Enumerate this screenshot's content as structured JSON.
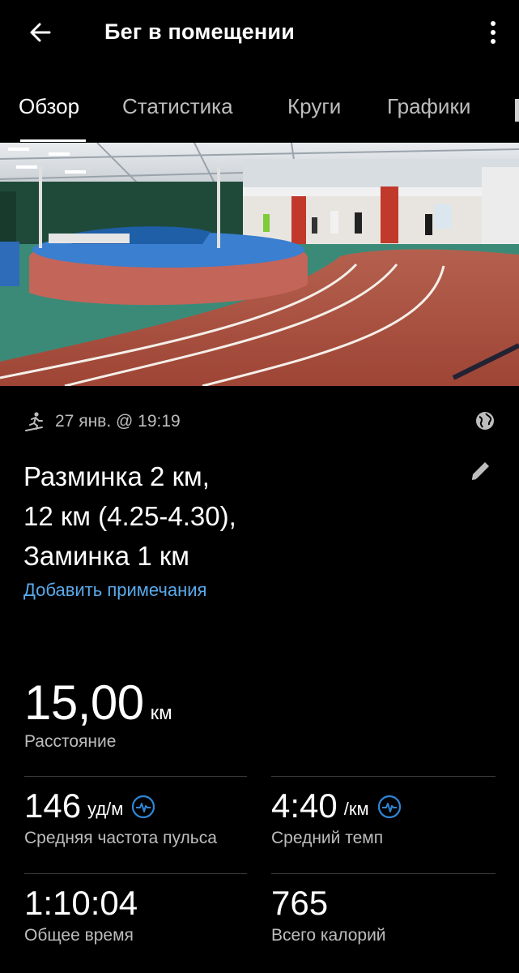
{
  "header": {
    "title": "Бег в помещении",
    "back_icon": "arrow-left-icon",
    "more_icon": "more-vertical-icon"
  },
  "tabs": [
    {
      "label": "Обзор",
      "active": true
    },
    {
      "label": "Статистика",
      "active": false
    },
    {
      "label": "Круги",
      "active": false
    },
    {
      "label": "Графики",
      "active": false
    }
  ],
  "activity": {
    "activity_icon": "treadmill-run-icon",
    "datetime": "27 янв. @ 19:19",
    "privacy_icon": "globe-icon",
    "name_lines": [
      "Разминка 2 км,",
      "12 км (4.25-4.30),",
      "Заминка 1 км"
    ],
    "edit_icon": "pencil-icon",
    "add_notes": "Добавить примечания"
  },
  "stats": {
    "distance": {
      "value": "15,00",
      "unit": "км",
      "label": "Расстояние"
    },
    "avg_hr": {
      "value": "146",
      "unit": "уд/м",
      "label": "Средняя частота пульса",
      "icon": "heart-rate-icon"
    },
    "avg_pace": {
      "value": "4:40",
      "unit": "/км",
      "label": "Средний темп",
      "icon": "heart-rate-icon"
    },
    "total_time": {
      "value": "1:10:04",
      "label": "Общее время"
    },
    "calories": {
      "value": "765",
      "label": "Всего калорий"
    }
  },
  "colors": {
    "background": "#000000",
    "link": "#5aa9ea",
    "secondary_text": "#bdbdbd",
    "icon_accent": "#2f86d6"
  }
}
